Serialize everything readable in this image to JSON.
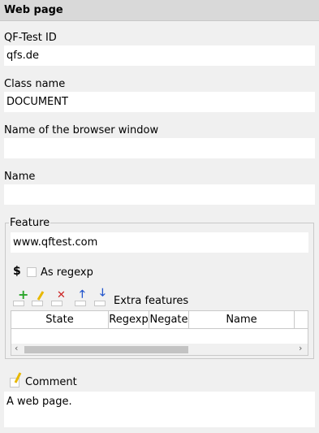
{
  "header": {
    "title": "Web page"
  },
  "fields": {
    "qftest_id": {
      "label": "QF-Test ID",
      "value": "qfs.de"
    },
    "class_name": {
      "label": "Class name",
      "value": "DOCUMENT"
    },
    "browser_window": {
      "label": "Name of the browser window",
      "value": ""
    },
    "name": {
      "label": "Name",
      "value": ""
    }
  },
  "feature": {
    "legend": "Feature",
    "value": "www.qftest.com",
    "regexp_symbol": "$",
    "regexp_label": "As regexp",
    "extra_features_label": "Extra features",
    "table": {
      "columns": [
        "State",
        "Regexp",
        "Negate",
        "Name"
      ]
    }
  },
  "comment": {
    "label": "Comment",
    "value": "A web page."
  },
  "colors": {
    "header_bg": "#d9d9d9",
    "panel_bg": "#f0f0f0",
    "add_green": "#2aa52a",
    "delete_red": "#cc2222",
    "move_blue": "#2255cc",
    "pencil_yellow": "#e8b800"
  }
}
